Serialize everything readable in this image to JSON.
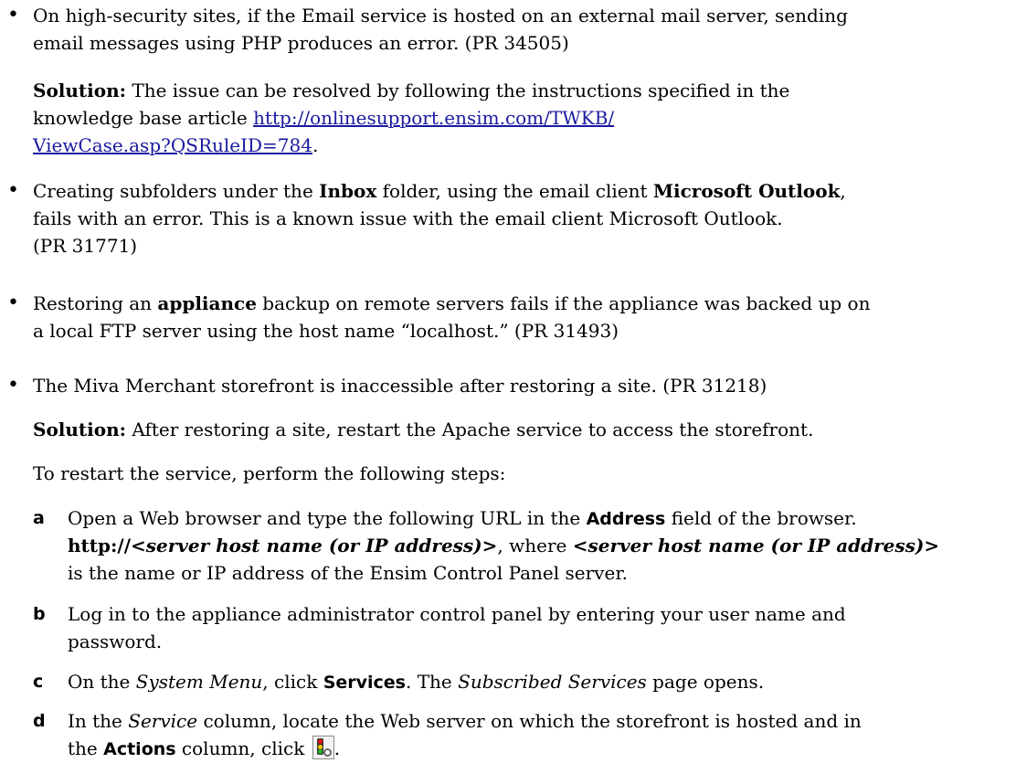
{
  "items": [
    {
      "lines": [
        "On high-security sites, if the Email service is hosted on an external mail server, sending",
        "email messages using PHP produces an error. (PR 34505)"
      ]
    },
    {
      "lines": [
        "Creating subfolders under the ",
        "Inbox",
        " folder, using the email client ",
        "Microsoft Outlook",
        ",",
        "fails with an error. This is a known issue with the email client Microsoft Outlook.",
        "(PR 31771)"
      ]
    },
    {
      "lines": [
        "Restoring an ",
        "appliance",
        " backup on remote servers fails if the appliance was backed up on",
        "a local FTP server using the host name “localhost.” (PR 31493)"
      ]
    },
    {
      "lines": [
        "The Miva Merchant storefront is inaccessible after restoring a site. (PR 31218)"
      ]
    }
  ],
  "solution1": {
    "label": "Solution:",
    "text1": " The issue can be resolved by following the instructions specified in the",
    "text2": "knowledge base article ",
    "link_line1": "http://onlinesupport.ensim.com/TWKB/",
    "link_line2": "ViewCase.asp?QSRuleID=784",
    "after_link": "."
  },
  "solution2": {
    "label": "Solution:",
    "text": " After restoring a site, restart the Apache service to access the storefront."
  },
  "intro": "To restart the service, perform the following steps:",
  "steps": [
    {
      "letter": "a",
      "l1a": "Open a Web browser and type the following URL in the ",
      "l1b": "Address",
      "l1c": " field of the browser.",
      "l2a": "http://",
      "l2b": "<server host name (or IP address)>",
      "l2c": ", where ",
      "l2d": "<server host name (or IP address)>",
      "l3": "is the name or IP address of the Ensim Control Panel server."
    },
    {
      "letter": "b",
      "l1": "Log in to the appliance administrator control panel by entering your user name and",
      "l2": "password."
    },
    {
      "letter": "c",
      "l1a": "On the ",
      "l1b": "System Menu",
      "l1c": ", click ",
      "l1d": "Services",
      "l1e": ". The ",
      "l1f": "Subscribed Services",
      "l1g": " page opens."
    },
    {
      "letter": "d",
      "l1a": "In the ",
      "l1b": "Service",
      "l1c": " column, locate the Web server on which the storefront is hosted and in",
      "l2a": "the ",
      "l2b": "Actions",
      "l2c": " column, click ",
      "l2d": "."
    }
  ],
  "icons": {
    "action_icon": "service-status-traffic-light-icon"
  }
}
